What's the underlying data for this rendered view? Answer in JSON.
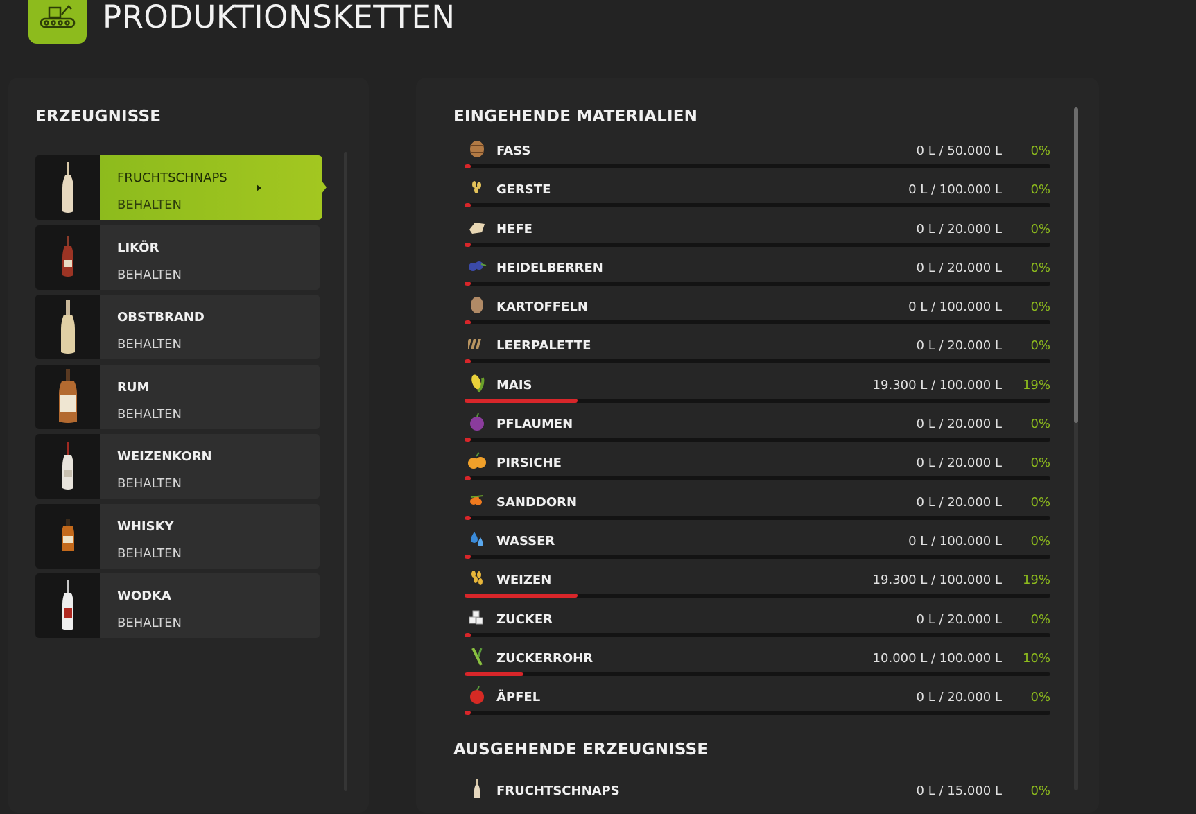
{
  "header": {
    "title": "PRODUKTIONSKETTEN",
    "icon": "production-chain-icon"
  },
  "left": {
    "title": "ERZEUGNISSE",
    "items": [
      {
        "name": "FRUCHTSCHNAPS",
        "mode": "BEHALTEN",
        "selected": true
      },
      {
        "name": "LIKÖR",
        "mode": "BEHALTEN"
      },
      {
        "name": "OBSTBRAND",
        "mode": "BEHALTEN"
      },
      {
        "name": "RUM",
        "mode": "BEHALTEN"
      },
      {
        "name": "WEIZENKORN",
        "mode": "BEHALTEN"
      },
      {
        "name": "WHISKY",
        "mode": "BEHALTEN"
      },
      {
        "name": "WODKA",
        "mode": "BEHALTEN"
      }
    ]
  },
  "incoming": {
    "title": "EINGEHENDE MATERIALIEN",
    "items": [
      {
        "name": "FASS",
        "amount": "0 L / 50.000 L",
        "percent": "0%",
        "fill": 0
      },
      {
        "name": "GERSTE",
        "amount": "0 L / 100.000 L",
        "percent": "0%",
        "fill": 0
      },
      {
        "name": "HEFE",
        "amount": "0 L / 20.000 L",
        "percent": "0%",
        "fill": 0
      },
      {
        "name": "HEIDELBERREN",
        "amount": "0 L / 20.000 L",
        "percent": "0%",
        "fill": 0
      },
      {
        "name": "KARTOFFELN",
        "amount": "0 L / 100.000 L",
        "percent": "0%",
        "fill": 0
      },
      {
        "name": "LEERPALETTE",
        "amount": "0 L / 20.000 L",
        "percent": "0%",
        "fill": 0
      },
      {
        "name": "MAIS",
        "amount": "19.300 L / 100.000 L",
        "percent": "19%",
        "fill": 0.193
      },
      {
        "name": "PFLAUMEN",
        "amount": "0 L / 20.000 L",
        "percent": "0%",
        "fill": 0
      },
      {
        "name": "PIRSICHE",
        "amount": "0 L / 20.000 L",
        "percent": "0%",
        "fill": 0
      },
      {
        "name": "SANDDORN",
        "amount": "0 L / 20.000 L",
        "percent": "0%",
        "fill": 0
      },
      {
        "name": "WASSER",
        "amount": "0 L / 100.000 L",
        "percent": "0%",
        "fill": 0
      },
      {
        "name": "WEIZEN",
        "amount": "19.300 L / 100.000 L",
        "percent": "19%",
        "fill": 0.193
      },
      {
        "name": "ZUCKER",
        "amount": "0 L / 20.000 L",
        "percent": "0%",
        "fill": 0
      },
      {
        "name": "ZUCKERROHR",
        "amount": "10.000 L / 100.000 L",
        "percent": "10%",
        "fill": 0.1
      },
      {
        "name": "ÄPFEL",
        "amount": "0 L / 20.000 L",
        "percent": "0%",
        "fill": 0
      }
    ]
  },
  "outgoing": {
    "title": "AUSGEHENDE ERZEUGNISSE",
    "items": [
      {
        "name": "FRUCHTSCHNAPS",
        "amount": "0 L / 15.000 L",
        "percent": "0%",
        "fill": 0
      }
    ]
  },
  "colors": {
    "accent": "#8dbb1d",
    "bar_fill": "#d8262a",
    "percent_text": "#8dbb1d"
  }
}
